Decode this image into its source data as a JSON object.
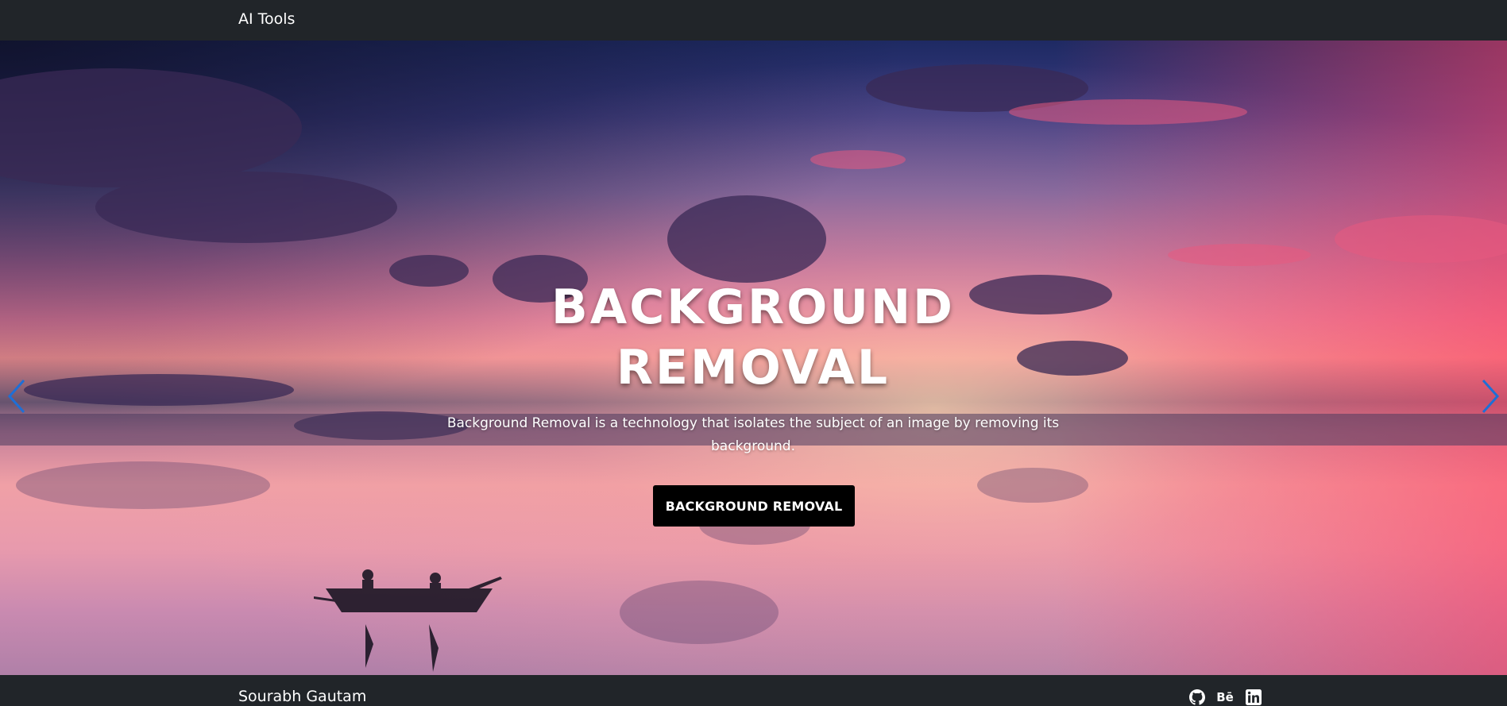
{
  "navbar": {
    "brand": "AI Tools"
  },
  "hero": {
    "title": "BACKGROUND REMOVAL",
    "description": "Background Removal is a technology that isolates the subject of an image by removing its background.",
    "button_label": "BACKGROUND REMOVAL",
    "prev_icon": "chevron-left-icon",
    "next_icon": "chevron-right-icon",
    "background_image": "sunset-lake-boat-photo"
  },
  "footer": {
    "name": "Sourabh Gautam",
    "social": [
      {
        "icon": "github-icon"
      },
      {
        "icon": "behance-icon",
        "text": "Bē"
      },
      {
        "icon": "linkedin-icon"
      }
    ]
  },
  "colors": {
    "navbar_bg": "#212529",
    "button_bg": "#000000",
    "control": "#1e6fd6",
    "text": "#ffffff"
  }
}
